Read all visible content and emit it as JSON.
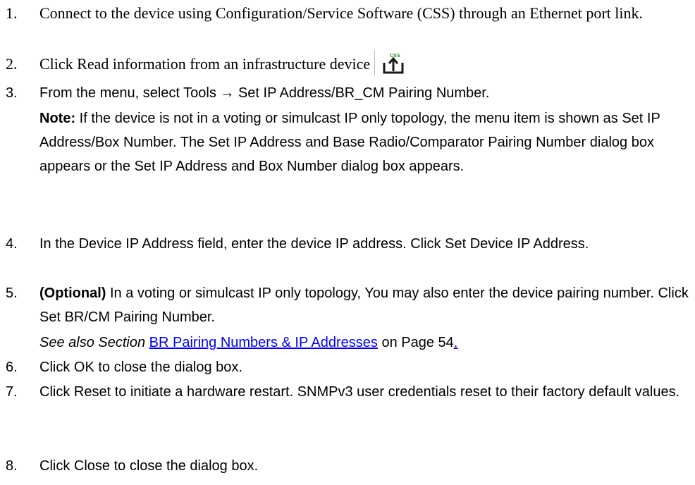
{
  "steps": [
    {
      "number": "1.",
      "text": "Connect to the device using Configuration/Service Software (CSS) through an Ethernet port link."
    },
    {
      "number": "2.",
      "text": "Click Read information from an infrastructure device",
      "icon": "read-from-device-icon",
      "icon_label": "css"
    },
    {
      "number": "3.",
      "text": "From the menu, select Tools → Set IP Address/BR_CM Pairing Number.",
      "note_label": "Note:",
      "note_text": " If the device is not in a voting or simulcast IP only topology, the menu item is shown as Set IP Address/Box Number. The Set IP Address and Base Radio/Comparator Pairing Number dialog box appears or the Set IP Address and Box Number dialog box appears."
    },
    {
      "number": "4.",
      "text": " In the Device IP Address field, enter the device IP address. Click Set Device IP Address."
    },
    {
      "number": "5.",
      "optional_label": " (Optional)",
      "text": " In a voting or simulcast IP only topology, You may also enter the device pairing number. Click Set BR/CM Pairing Number.",
      "see_also_prefix": "See also Section",
      "link_text": "BR Pairing Numbers & IP Addresses",
      "see_also_suffix": " on Page 54",
      "trailing_link": "."
    },
    {
      "number": "6.",
      "text": "Click OK to close the dialog box."
    },
    {
      "number": "7.",
      "text": "Click Reset to initiate a hardware restart. SNMPv3 user credentials reset to their factory default values."
    },
    {
      "number": "8.",
      "text": "Click Close to close the dialog box."
    }
  ],
  "colors": {
    "link": "#0000ee",
    "icon_green": "#2e9e3b",
    "icon_dark": "#1a1a1a"
  }
}
